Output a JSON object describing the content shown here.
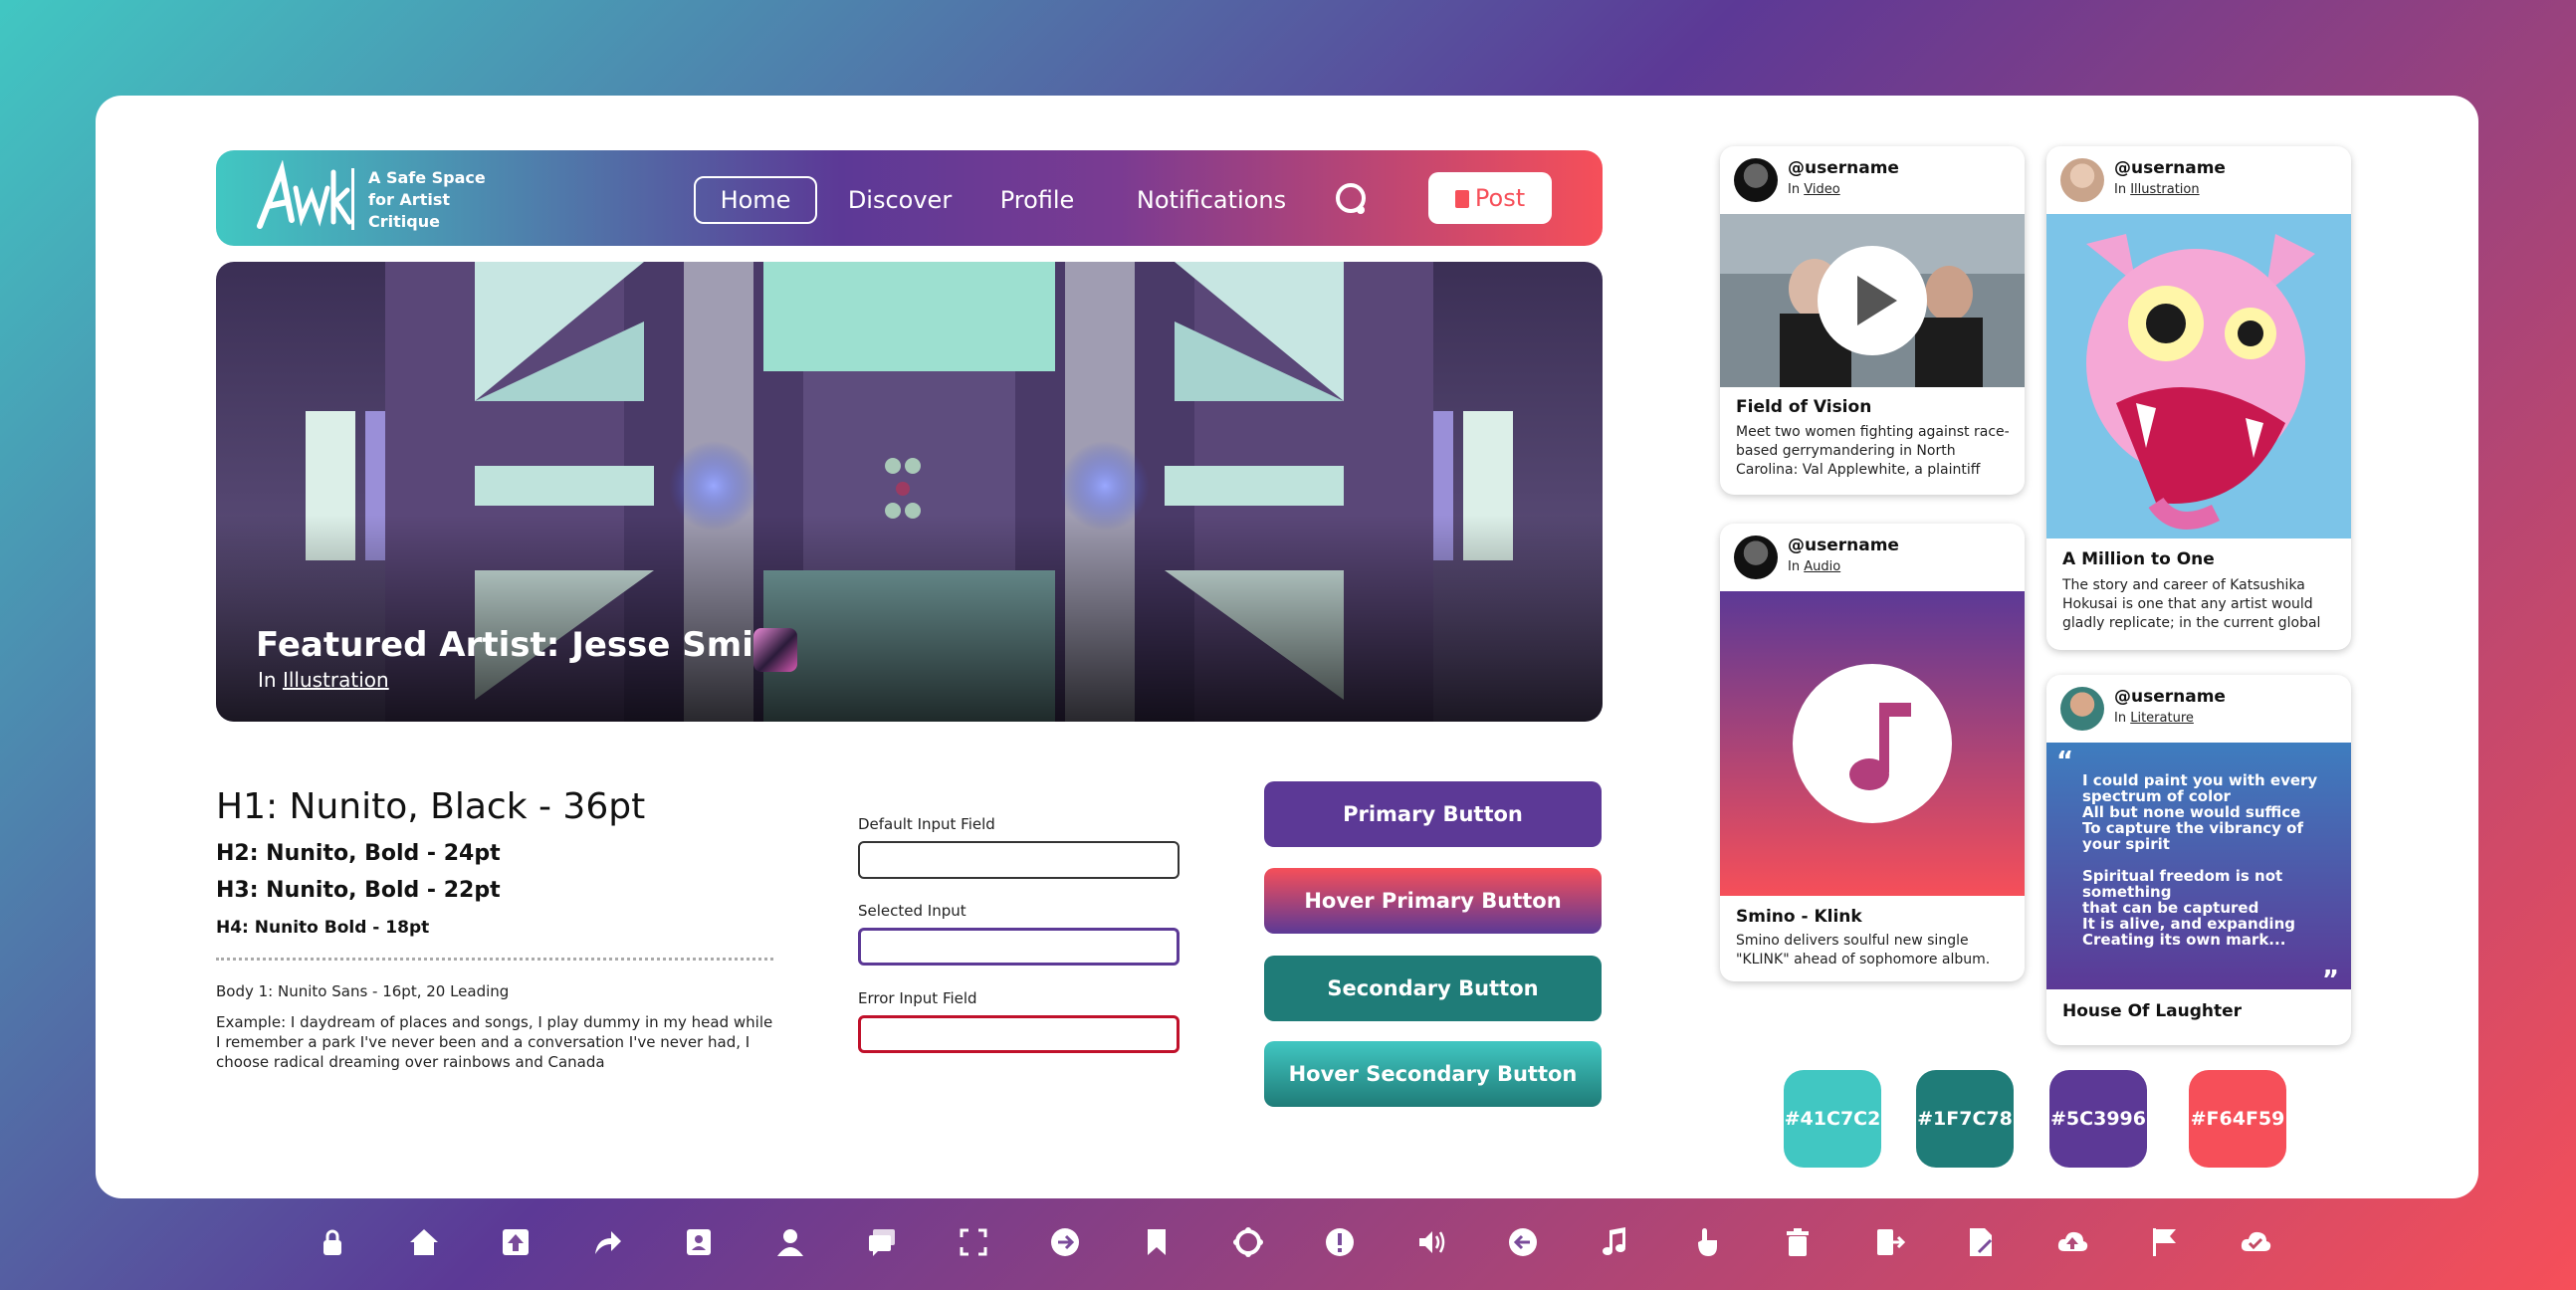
{
  "brand": {
    "tagline": "A Safe Space for Artist Critique"
  },
  "nav": {
    "items": [
      "Home",
      "Discover",
      "Profile",
      "Notifications"
    ],
    "active": "Home",
    "post_label": "Post"
  },
  "hero": {
    "title": "Featured Artist: Jesse Smith",
    "in_prefix": "In",
    "category": "Illustration"
  },
  "typography": {
    "h1": "H1: Nunito, Black - 36pt",
    "h2": "H2: Nunito, Bold - 24pt",
    "h3": "H3: Nunito, Bold - 22pt",
    "h4": "H4: Nunito Bold - 18pt",
    "body1": "Body 1: Nunito Sans - 16pt, 20 Leading",
    "example": "Example: I daydream of places and songs, I play dummy in my head while I remember a park I've never been and a conversation I've never had, I choose radical dreaming over rainbows and Canada"
  },
  "inputs": {
    "default_label": "Default Input Field",
    "selected_label": "Selected Input",
    "error_label": "Error Input Field"
  },
  "buttons": {
    "primary": "Primary Button",
    "hover_primary": "Hover Primary Button",
    "secondary": "Secondary Button",
    "hover_secondary": "Hover Secondary Button"
  },
  "cards": {
    "video": {
      "username": "@username",
      "in_prefix": "In",
      "category": "Video",
      "title": "Field of Vision",
      "desc": "Meet two women fighting against race-based gerrymandering in North Carolina: Val Applewhite, a plaintiff"
    },
    "illustration": {
      "username": "@username",
      "in_prefix": "In",
      "category": "Illustration",
      "title": "A Million to One",
      "desc": "The story and career of Katsushika Hokusai is one that any artist would gladly replicate; in the current global"
    },
    "audio": {
      "username": "@username",
      "in_prefix": "In",
      "category": "Audio",
      "title": "Smino - Klink",
      "desc": "Smino delivers soulful new single \"KLINK\" ahead of sophomore album."
    },
    "literature": {
      "username": "@username",
      "in_prefix": "In",
      "category": "Literature",
      "quote": "I could paint you with every spectrum of color\nAll but none would suffice\nTo capture the vibrancy of your spirit\n\nSpiritual freedom is not something\n that can be captured\nIt is alive, and expanding\nCreating its own mark...",
      "open_quote": "“",
      "close_quote": "”",
      "title": "House Of Laughter"
    }
  },
  "swatches": [
    {
      "label": "#41C7C2",
      "color": "#41C7C2"
    },
    {
      "label": "#1F7C78",
      "color": "#1F7C78"
    },
    {
      "label": "#5C3996",
      "color": "#5C3996"
    },
    {
      "label": "#F64F59",
      "color": "#F64F59"
    }
  ],
  "icon_bar": [
    "lock-icon",
    "home-icon",
    "upload-icon",
    "share-icon",
    "contact-card-icon",
    "user-icon",
    "chat-icon",
    "fullscreen-icon",
    "arrow-right-icon",
    "bookmark-icon",
    "refresh-icon",
    "alert-icon",
    "volume-icon",
    "arrow-left-icon",
    "music-note-icon",
    "pointer-hand-icon",
    "trash-icon",
    "logout-icon",
    "document-edit-icon",
    "cloud-upload-icon",
    "flag-icon",
    "cloud-check-icon"
  ]
}
